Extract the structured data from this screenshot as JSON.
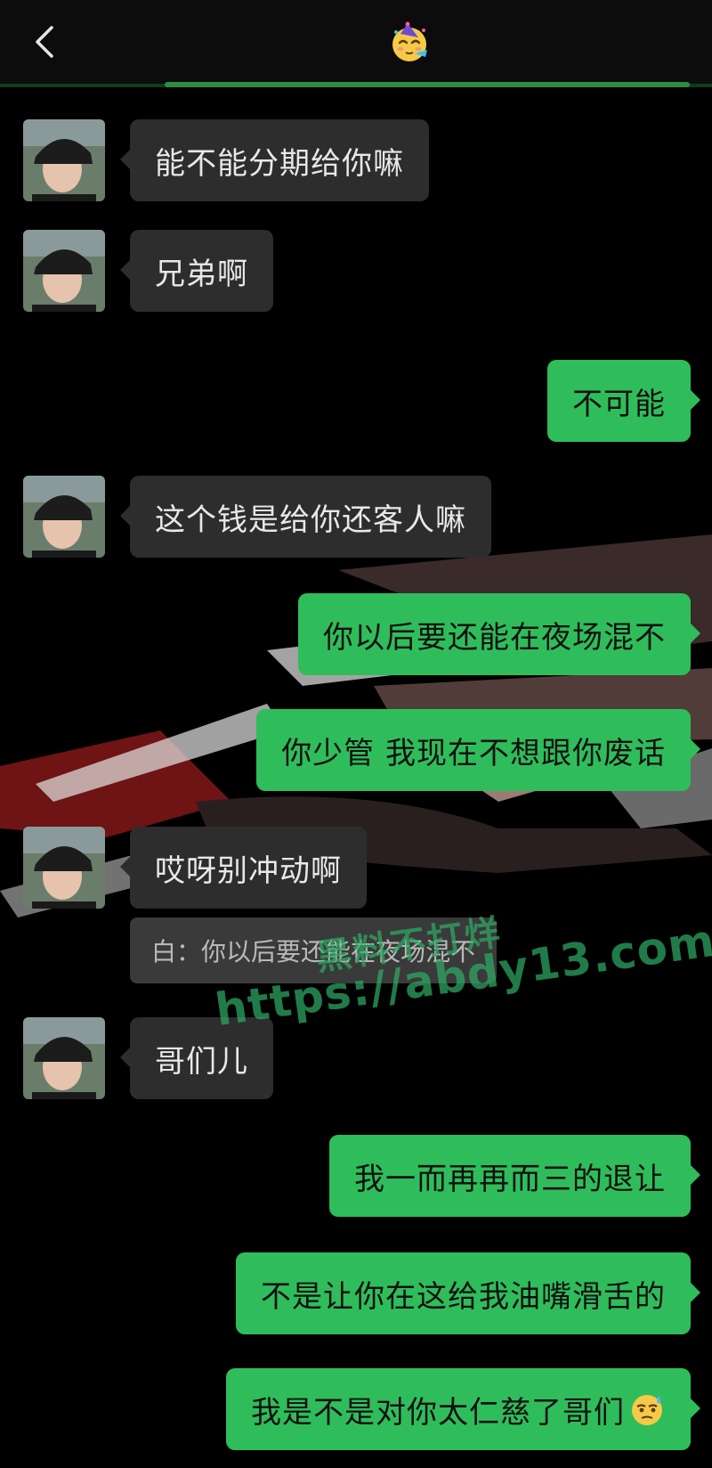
{
  "header": {
    "title_icon": "party-face-emoji",
    "back_icon": "chevron-left-icon"
  },
  "messages": [
    {
      "side": "in",
      "text": "能不能分期给你嘛"
    },
    {
      "side": "in",
      "text": "兄弟啊"
    },
    {
      "side": "out",
      "text": "不可能"
    },
    {
      "side": "in",
      "text": "这个钱是给你还客人嘛"
    },
    {
      "side": "out",
      "text": "你以后要还能在夜场混不"
    },
    {
      "side": "out",
      "text": "你少管 我现在不想跟你废话"
    },
    {
      "side": "in",
      "text": "哎呀别冲动啊",
      "quote": "白：你以后要还能在夜场混不"
    },
    {
      "side": "in",
      "text": "哥们儿"
    },
    {
      "side": "out",
      "text": "我一而再再而三的退让"
    },
    {
      "side": "out",
      "text": "不是让你在这给我油嘴滑舌的"
    },
    {
      "side": "out",
      "text": "我是不是对你太仁慈了哥们",
      "emoji": "sweat-face-emoji"
    }
  ],
  "watermark": {
    "line1": "黑料不打烊",
    "line2": "https://abdy13.com"
  },
  "colors": {
    "background": "#000000",
    "incoming_bubble": "#2d2d2d",
    "outgoing_bubble": "#2fbd5b",
    "watermark": "#2eaa64"
  }
}
